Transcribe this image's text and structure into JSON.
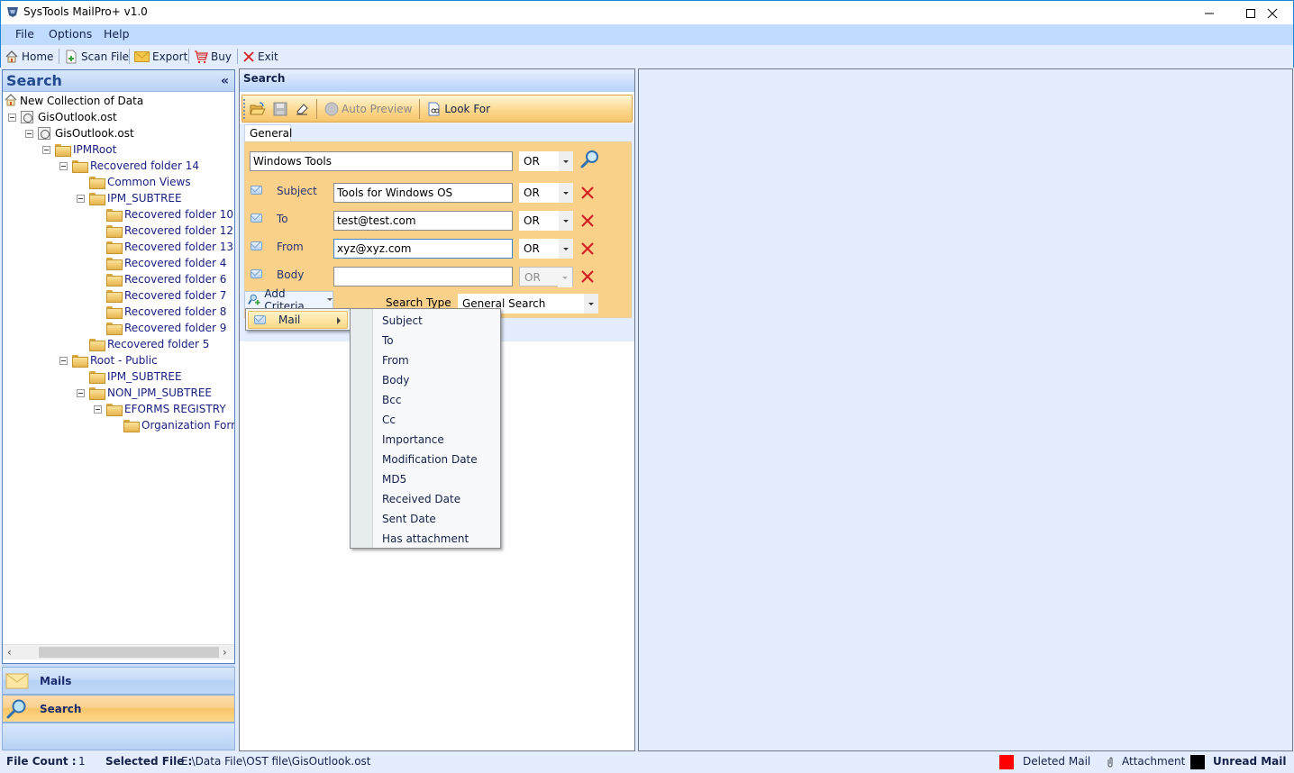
{
  "window": {
    "title": "SysTools MailPro+ v1.0",
    "controls": [
      "minimize",
      "maximize",
      "close"
    ]
  },
  "menu": {
    "items": [
      "File",
      "Options",
      "Help"
    ]
  },
  "toolbar": {
    "items": [
      {
        "label": "Home",
        "icon": "home-icon"
      },
      {
        "label": "Scan File",
        "icon": "scan-file-icon"
      },
      {
        "label": "Export",
        "icon": "envelope-icon"
      },
      {
        "label": "Buy",
        "icon": "cart-icon"
      },
      {
        "label": "Exit",
        "icon": "close-x-icon"
      }
    ]
  },
  "left_panel": {
    "title": "Search",
    "collapse_glyph": "«",
    "tree": [
      {
        "label": "New Collection of Data",
        "type": "collection"
      },
      {
        "label": "GisOutlook.ost",
        "type": "file"
      },
      {
        "label": "GisOutlook.ost",
        "type": "file"
      },
      {
        "label": "IPMRoot",
        "type": "folder"
      },
      {
        "label": "Recovered folder 14",
        "type": "folder"
      },
      {
        "label": "Common Views",
        "type": "folder"
      },
      {
        "label": "IPM_SUBTREE",
        "type": "folder"
      },
      {
        "label": "Recovered folder 10",
        "type": "folder"
      },
      {
        "label": "Recovered folder 12",
        "type": "folder"
      },
      {
        "label": "Recovered folder 13",
        "type": "folder"
      },
      {
        "label": "Recovered folder 4",
        "type": "folder"
      },
      {
        "label": "Recovered folder 6",
        "type": "folder"
      },
      {
        "label": "Recovered folder 7",
        "type": "folder"
      },
      {
        "label": "Recovered folder 8",
        "type": "folder"
      },
      {
        "label": "Recovered folder 9",
        "type": "folder"
      },
      {
        "label": "Recovered folder 5",
        "type": "folder"
      },
      {
        "label": "Root - Public",
        "type": "folder"
      },
      {
        "label": "IPM_SUBTREE",
        "type": "folder"
      },
      {
        "label": "NON_IPM_SUBTREE",
        "type": "folder"
      },
      {
        "label": "EFORMS REGISTRY",
        "type": "folder"
      },
      {
        "label": "Organization Forms",
        "type": "folder"
      }
    ],
    "nav": [
      {
        "label": "Mails",
        "icon": "envelope-icon",
        "active": false
      },
      {
        "label": "Search",
        "icon": "magnifier-icon",
        "active": true
      }
    ]
  },
  "search_panel": {
    "title": "Search",
    "toolbar": {
      "open": "open-folder-icon",
      "save": "save-icon",
      "clear": "eraser-icon",
      "auto_preview": "Auto Preview",
      "look_for": "Look For"
    },
    "tab": "General",
    "keyword": {
      "value": "Windows Tools",
      "operator": "OR"
    },
    "criteria": [
      {
        "label": "Subject",
        "value": "Tools for Windows OS",
        "operator": "OR",
        "disabled": false
      },
      {
        "label": "To",
        "value": "test@test.com",
        "operator": "OR",
        "disabled": false
      },
      {
        "label": "From",
        "value": "xyz@xyz.com",
        "operator": "OR",
        "disabled": false
      },
      {
        "label": "Body",
        "value": "",
        "operator": "OR",
        "disabled": true
      }
    ],
    "add_criteria": "Add Criteria",
    "search_type_label": "Search Type",
    "search_type_value": "General Search"
  },
  "add_criteria_menu": {
    "item": "Mail",
    "submenu": [
      "Subject",
      "To",
      "From",
      "Body",
      "Bcc",
      "Cc",
      "Importance",
      "Modification Date",
      "MD5",
      "Received Date",
      "Sent Date",
      "Has attachment"
    ]
  },
  "statusbar": {
    "file_count_label": "File Count :",
    "file_count": "1",
    "selected_file_label": "Selected File :",
    "selected_file": "E:\\Data File\\OST file\\GisOutlook.ost",
    "legend": [
      {
        "label": "Deleted Mail",
        "color": "#ff0000"
      },
      {
        "label": "Attachment",
        "icon": "paperclip-icon"
      },
      {
        "label": "Unread Mail",
        "color": "#000000"
      }
    ]
  }
}
